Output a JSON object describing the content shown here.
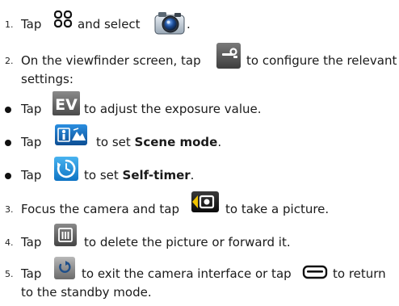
{
  "steps": [
    {
      "number": "1.",
      "pre": "Tap",
      "mid": "and select",
      "post": "."
    },
    {
      "number": "2.",
      "pre": "On the viewfinder screen, tap",
      "post": "to configure the relevant",
      "post2": "settings:"
    },
    {
      "number": "3.",
      "pre": "Focus the camera and tap",
      "post": "to take a picture."
    },
    {
      "number": "4.",
      "pre": "Tap",
      "post": "to delete the picture or forward it."
    },
    {
      "number": "5.",
      "pre": "Tap",
      "mid": "to exit the camera interface or tap",
      "post": "to return",
      "post2": "to the standby mode."
    }
  ],
  "bullets": [
    {
      "pre": "Tap",
      "post": "to adjust the exposure value."
    },
    {
      "pre": "Tap",
      "post": "to set",
      "bold": "Scene mode",
      "end": "."
    },
    {
      "pre": "Tap",
      "post": "to set",
      "bold": "Self-timer",
      "end": "."
    }
  ],
  "icons": {
    "ev_text": "EV"
  }
}
